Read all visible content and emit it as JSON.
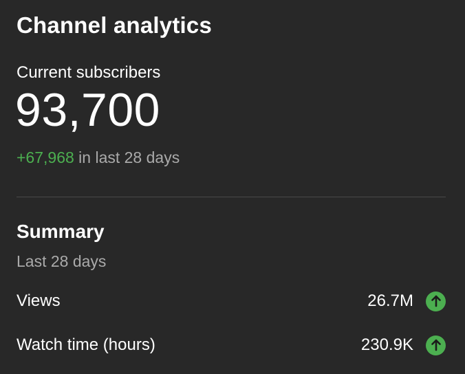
{
  "header": {
    "title": "Channel analytics"
  },
  "subscribers": {
    "label": "Current subscribers",
    "count": "93,700",
    "delta": "+67,968",
    "delta_suffix": " in last 28 days"
  },
  "summary": {
    "title": "Summary",
    "period": "Last 28 days",
    "metrics": [
      {
        "label": "Views",
        "value": "26.7M",
        "trend_icon": "arrow-up-icon"
      },
      {
        "label": "Watch time (hours)",
        "value": "230.9K",
        "trend_icon": "arrow-up-icon"
      }
    ]
  },
  "colors": {
    "background": "#282828",
    "positive": "#4caf50",
    "secondary_text": "#aaaaaa"
  }
}
